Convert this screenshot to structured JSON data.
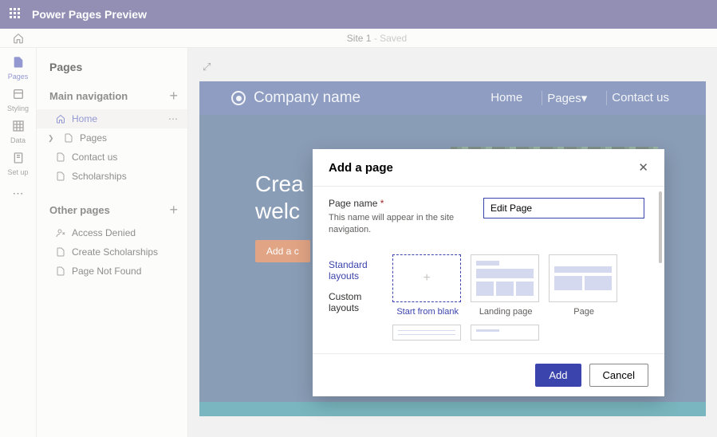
{
  "titlebar": {
    "title": "Power Pages Preview"
  },
  "cmdbar": {
    "sitename": "Site 1",
    "savestate": " - Saved"
  },
  "rail": {
    "items": [
      {
        "label": "Pages"
      },
      {
        "label": "Styling"
      },
      {
        "label": "Data"
      },
      {
        "label": "Set up"
      }
    ]
  },
  "pagespanel": {
    "heading": "Pages",
    "mainnav_label": "Main navigation",
    "otherpages_label": "Other pages",
    "main_items": [
      {
        "label": "Home",
        "icon": "home"
      },
      {
        "label": "Pages",
        "icon": "page",
        "expandable": true
      },
      {
        "label": "Contact us",
        "icon": "page"
      },
      {
        "label": "Scholarships",
        "icon": "page"
      }
    ],
    "other_items": [
      {
        "label": "Access Denied",
        "icon": "person"
      },
      {
        "label": "Create Scholarships",
        "icon": "page"
      },
      {
        "label": "Page Not Found",
        "icon": "page"
      }
    ]
  },
  "sitepreview": {
    "company": "Company name",
    "nav": [
      "Home",
      "Pages▾",
      "Contact us"
    ],
    "hero_line1": "Crea",
    "hero_line2": "welc",
    "cta": "Add a c"
  },
  "modal": {
    "title": "Add a page",
    "field_label": "Page name",
    "field_help": "This name will appear in the site navigation.",
    "field_value": "Edit Page",
    "tab_standard": "Standard layouts",
    "tab_custom": "Custom layouts",
    "layouts": [
      {
        "name": "Start from blank"
      },
      {
        "name": "Landing page"
      },
      {
        "name": "Page"
      }
    ],
    "add": "Add",
    "cancel": "Cancel"
  }
}
